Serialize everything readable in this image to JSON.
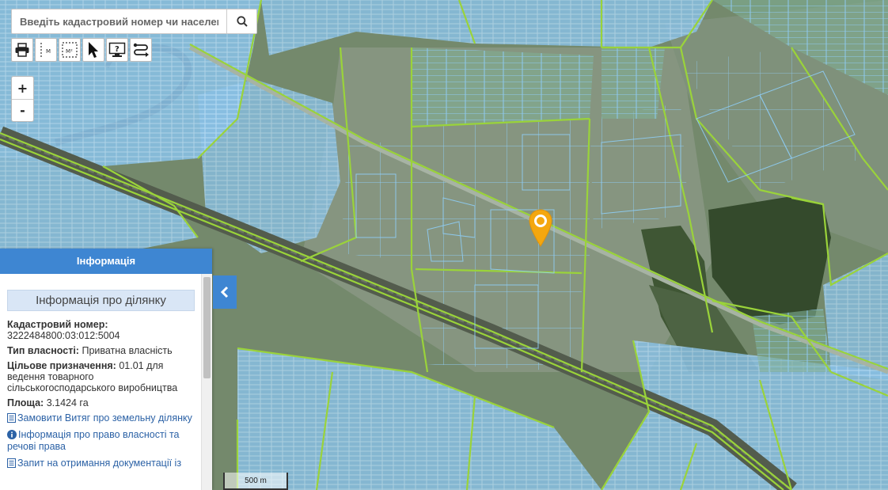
{
  "search": {
    "placeholder": "Введіть кадастровий номер чи населений"
  },
  "toolbar": {
    "tools": [
      {
        "icon": "printer-icon",
        "name": "print-button"
      },
      {
        "icon": "measure-length-icon",
        "name": "measure-length-button",
        "label": "M"
      },
      {
        "icon": "measure-area-icon",
        "name": "measure-area-button",
        "label": "M²"
      },
      {
        "icon": "cursor-icon",
        "name": "select-button"
      },
      {
        "icon": "info-monitor-icon",
        "name": "identify-button"
      },
      {
        "icon": "route-icon",
        "name": "route-button"
      }
    ]
  },
  "zoom": {
    "in_label": "+",
    "out_label": "-"
  },
  "panel": {
    "header": "Інформація",
    "section_title": "Інформація про ділянку",
    "cadastral_label": "Кадастровий номер:",
    "cadastral_value": "3222484800:03:012:5004",
    "ownership_label": "Тип власності:",
    "ownership_value": "Приватна власність",
    "purpose_label": "Цільове призначення:",
    "purpose_value": "01.01 для ведення товарного сільськогосподарського виробництва",
    "area_label": "Площа:",
    "area_value": "3.1424 га",
    "links": {
      "extract": "Замовити Витяг про земельну ділянку",
      "ownership_info": "Інформація про право власності та речові права",
      "documents": "Запит на отримання документації із"
    }
  },
  "scale": {
    "label": "500 m"
  },
  "colors": {
    "accent": "#3e86d2",
    "parcel_fill": "#8ec3e8",
    "parcel_line": "#7fc4f2",
    "boundary_line": "#9ad33a",
    "marker": "#f4a70f"
  }
}
